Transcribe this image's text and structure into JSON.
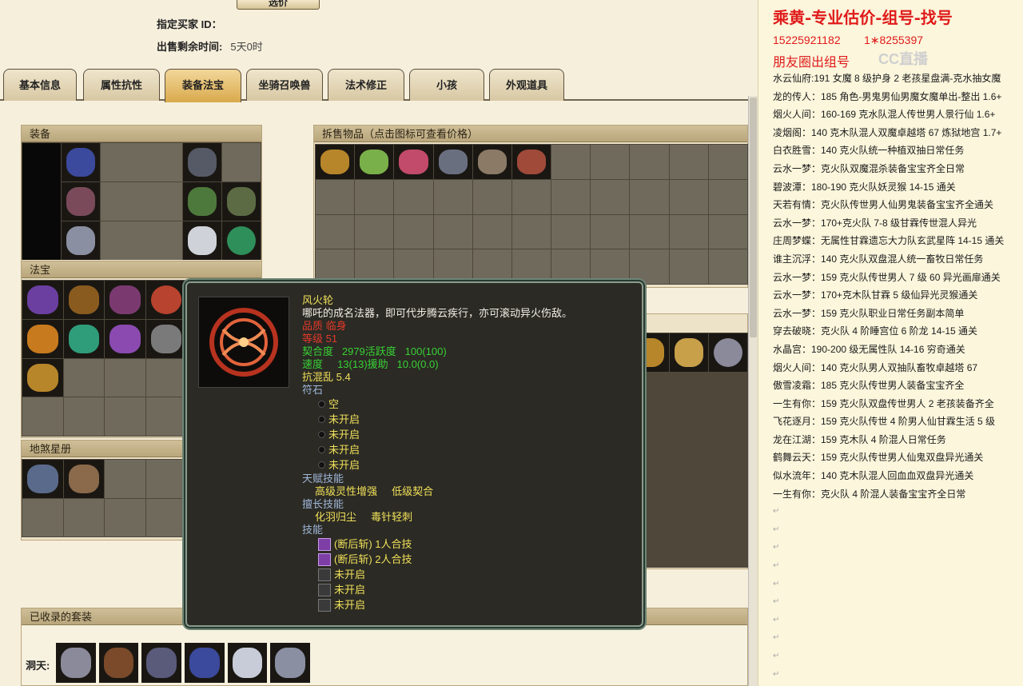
{
  "header": {
    "top_button_label": "选价",
    "buyer_id_label": "指定买家 ID：",
    "time_left_label": "出售剩余时间:",
    "time_left_value": "5天0时"
  },
  "tabs": [
    "基本信息",
    "属性抗性",
    "装备法宝",
    "坐骑召唤兽",
    "法术修正",
    "小孩",
    "外观道具"
  ],
  "active_tab": "装备法宝",
  "panels": {
    "equip": "装备",
    "treasure": "法宝",
    "star_book": "地煞星册",
    "sell_items": "拆售物品（点击图标可查看价格）",
    "collected_sets": "已收录的套装",
    "dongtian_label": "洞天:"
  },
  "tooltip": {
    "name": "风火轮",
    "desc": "哪吒的成名法器，即可代步腾云疾行，亦可滚动异火伤敌。",
    "grade_label": "品质",
    "grade_value": "临身",
    "level_label": "等级",
    "level_value": "51",
    "fit_label": "契合度",
    "fit_activity": "2979活跃度",
    "fit_value": "100(100)",
    "speed_label": "速度",
    "speed_assist": "13(13)援助",
    "speed_value": "10.0(0.0)",
    "resist": "抗混乱 5.4",
    "rune_label": "符石",
    "rune_slots": [
      "空",
      "未开启",
      "未开启",
      "未开启",
      "未开启"
    ],
    "talent_label": "天赋技能",
    "talents": [
      "高级灵性增强",
      "低级契合"
    ],
    "special_label": "擅长技能",
    "specials": [
      "化羽归尘",
      "毒针轻刺"
    ],
    "skill_label": "技能",
    "skills": [
      "(断后斩) 1人合技",
      "(断后斩) 2人合技",
      "未开启",
      "未开启",
      "未开启"
    ]
  },
  "notes": {
    "title": "乘黄-专业估价-组号-找号",
    "phone1": "15225921182",
    "phone2": "1∗8255397",
    "circle": "朋友圈出组号",
    "watermark": "CC直播",
    "lines": [
      "水云仙府:191 女魔 8 级护身 2 老孩星盘满-克水抽女魔",
      "龙的传人：185 角色-男鬼男仙男魔女魔单出-整出 1.6+",
      "烟火人间：160-169 克水队混人传世男人景行仙 1.6+",
      "凌烟阁：140 克木队混人双魔卓越塔 67 炼狱地宫 1.7+",
      "白衣胜雪：140 克火队统一种植双抽日常任务",
      "云水一梦：克火队双魔混杀装备宝宝齐全日常",
      "碧波潭：180-190 克火队妖灵猴 14-15 通关",
      "天若有情：克火队传世男人仙男鬼装备宝宝齐全通关",
      "云水一梦：170+克火队 7-8 级甘霖传世混人异光",
      "庄周梦蝶：无属性甘霖遗忘大力队玄武星阵 14-15 通关",
      "谁主沉浮：140 克火队双盘混人统一畜牧日常任务",
      "云水一梦：159 克火队传世男人 7 级 60 异光画扉通关",
      "云水一梦：170+克木队甘霖 5 级仙异光灵猴通关",
      "云水一梦：159 克火队职业日常任务副本简单",
      "穿去破晓：克火队 4 阶睡宫位 6 阶龙 14-15 通关",
      "水晶宫：190-200 级无属性队 14-16 穷奇通关",
      "烟火人间：140 克火队男人双抽队畜牧卓越塔 67",
      "傲雪凌霜：185 克火队传世男人装备宝宝齐全",
      "一生有你：159 克火队双盘传世男人 2 老孩装备齐全",
      "飞花逐月：159 克火队传世 4 阶男人仙甘霖生活 5 级",
      "龙在江湖：159 克木队 4 阶混人日常任务",
      "鹤舞云天：159 克火队传世男人仙鬼双盘异光通关",
      "似水流年：140 克木队混人回血血双盘异光通关",
      "一生有你：克火队 4 阶混人装备宝宝齐全日常"
    ],
    "return_mark": "↵"
  }
}
